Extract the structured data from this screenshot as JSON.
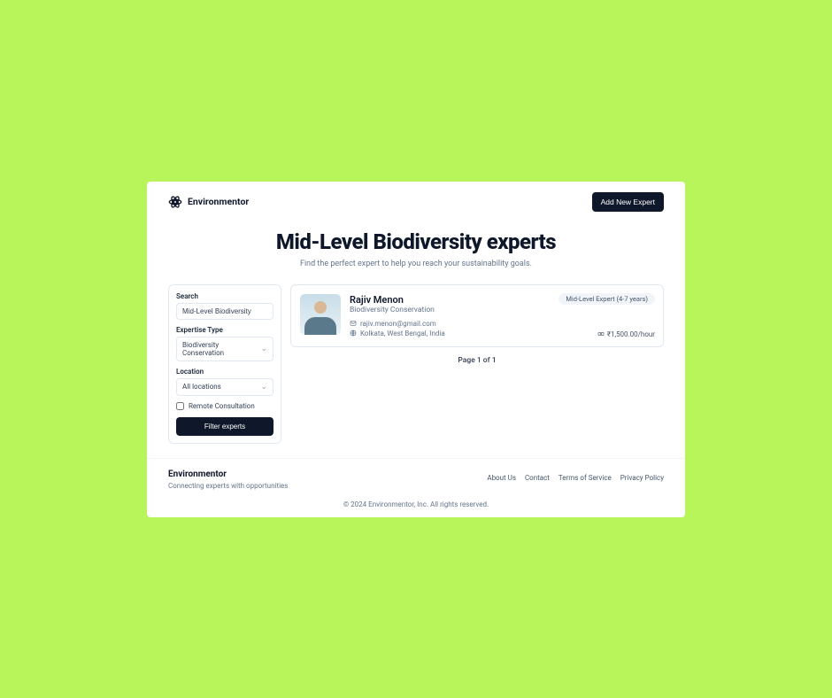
{
  "brand": "Environmentor",
  "header": {
    "add_button": "Add New Expert"
  },
  "hero": {
    "title": "Mid-Level Biodiversity experts",
    "subtitle": "Find the perfect expert to help you reach your sustainability goals."
  },
  "filters": {
    "search_label": "Search",
    "search_value": "Mid-Level Biodiversity",
    "expertise_label": "Expertise Type",
    "expertise_value": "Biodiversity Conservation",
    "location_label": "Location",
    "location_value": "All locations",
    "remote_label": "Remote Consultation",
    "button": "Filter experts"
  },
  "expert": {
    "name": "Rajiv Menon",
    "field": "Biodiversity Conservation",
    "email": "rajiv.menon@gmail.com",
    "location": "Kolkata, West Bengal, India",
    "badge": "Mid-Level Expert (4-7 years)",
    "rate": "₹1,500.00/hour"
  },
  "pagination": "Page 1 of 1",
  "footer": {
    "brand": "Environmentor",
    "tagline": "Connecting experts with opportunities",
    "links": {
      "about": "About Us",
      "contact": "Contact",
      "terms": "Terms of Service",
      "privacy": "Privacy Policy"
    },
    "copyright": "© 2024 Environmentor, Inc. All rights reserved."
  }
}
